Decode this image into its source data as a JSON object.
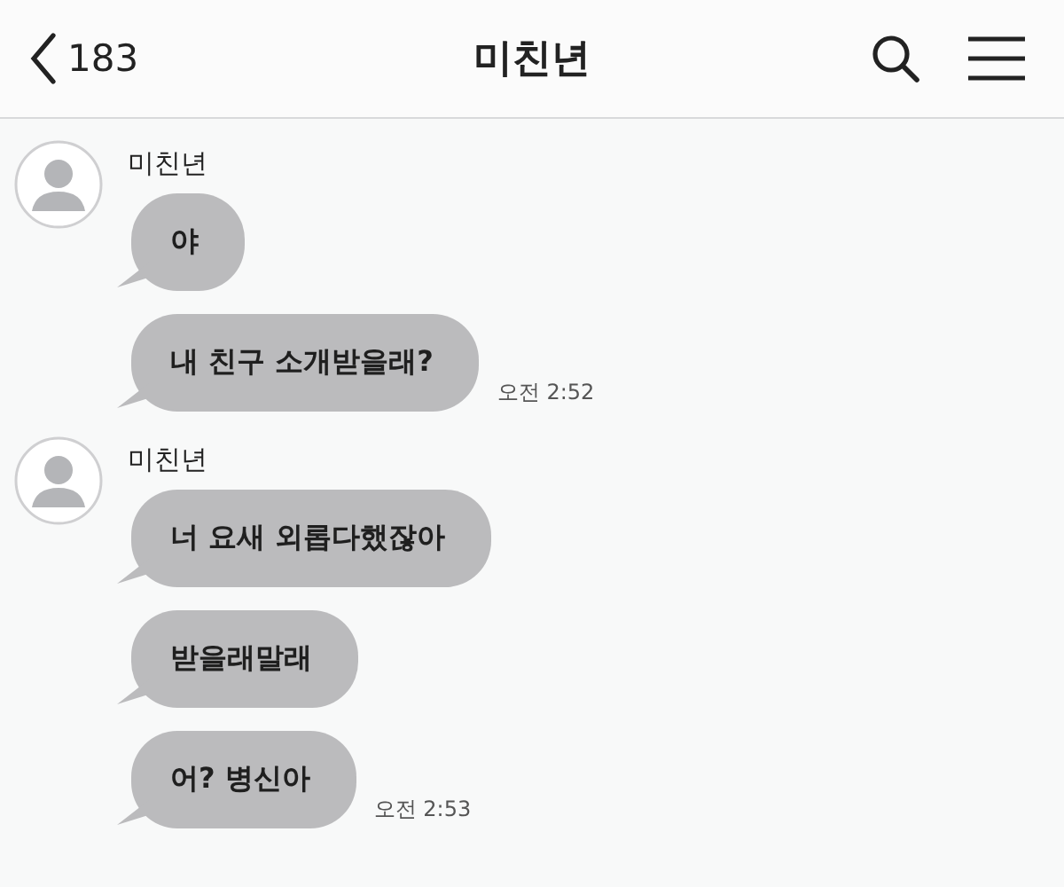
{
  "header": {
    "unread_count": "183",
    "title": "미친년"
  },
  "groups": [
    {
      "sender": "미친년",
      "messages": [
        {
          "text": "야"
        },
        {
          "text": "내 친구 소개받을래?",
          "time": "오전 2:52"
        }
      ]
    },
    {
      "sender": "미친년",
      "messages": [
        {
          "text": "너 요새 외롭다했잖아"
        },
        {
          "text": "받을래말래"
        },
        {
          "text": "어? 병신아",
          "time": "오전 2:53"
        }
      ]
    }
  ]
}
